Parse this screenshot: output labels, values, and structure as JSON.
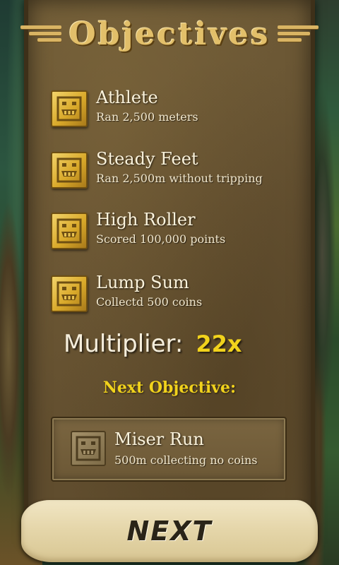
{
  "title": "Objectives",
  "objectives": [
    {
      "title": "Athlete",
      "desc": "Ran 2,500 meters",
      "icon": "idol-icon"
    },
    {
      "title": "Steady Feet",
      "desc": "Ran 2,500m without tripping",
      "icon": "idol-icon"
    },
    {
      "title": "High Roller",
      "desc": "Scored 100,000 points",
      "icon": "idol-icon"
    },
    {
      "title": "Lump Sum",
      "desc": "Collectd 500 coins",
      "icon": "idol-icon"
    }
  ],
  "multiplier": {
    "label": "Multiplier:",
    "value": "22x"
  },
  "next_objective": {
    "label": "Next Objective:",
    "title": "Miser Run",
    "desc": "500m collecting no coins",
    "icon": "idol-locked-icon"
  },
  "next_button": "NEXT",
  "colors": {
    "gold": "#e2bf6a",
    "yellow": "#f1d21c",
    "panel": "#665232"
  }
}
